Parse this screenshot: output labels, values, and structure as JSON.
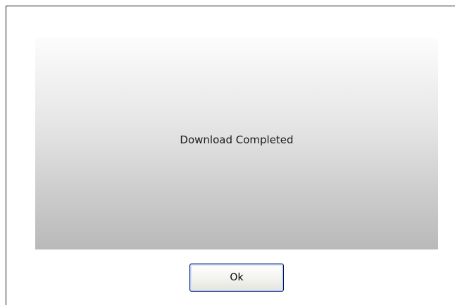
{
  "dialog": {
    "message": "Download Completed",
    "ok_label": "Ok"
  },
  "colors": {
    "panel_top": "#fcfcfc",
    "panel_bottom": "#b9b9b9",
    "button_border": "#00135c",
    "window_border": "#1a1a1a"
  }
}
